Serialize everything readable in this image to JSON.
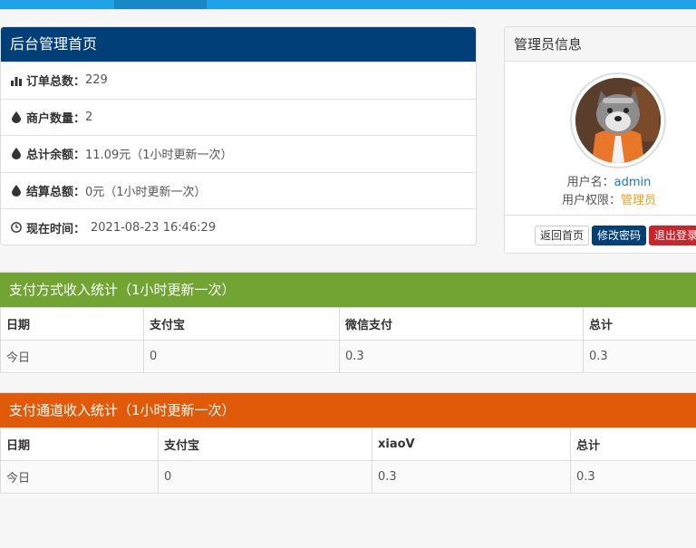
{
  "dashboard": {
    "title": "后台管理首页",
    "stats": [
      {
        "icon": "bar-chart-icon",
        "label": "订单总数：",
        "value": "229"
      },
      {
        "icon": "drop-icon",
        "label": "商户数量：",
        "value": "2"
      },
      {
        "icon": "drop-icon",
        "label": "总计余额：",
        "value": "11.09元（1小时更新一次）"
      },
      {
        "icon": "drop-icon",
        "label": "结算总额：",
        "value": "0元（1小时更新一次）"
      },
      {
        "icon": "clock-icon",
        "label": "现在时间：",
        "value": "2021-08-23 16:46:29"
      }
    ]
  },
  "admin": {
    "title": "管理员信息",
    "username_label": "用户名：",
    "username": "admin",
    "role_label": "用户权限：",
    "role": "管理员",
    "buttons": {
      "home": "返回首页",
      "change_password": "修改密码",
      "logout": "退出登录"
    }
  },
  "pay_stats": {
    "title": "支付方式收入统计（1小时更新一次）",
    "headers": [
      "日期",
      "支付宝",
      "微信支付",
      "总计"
    ],
    "row": [
      "今日",
      "0",
      "0.3",
      "0.3"
    ]
  },
  "channel_stats": {
    "title": "支付通道收入统计（1小时更新一次）",
    "headers": [
      "日期",
      "支付宝",
      "xiaoV",
      "总计"
    ],
    "row": [
      "今日",
      "0",
      "0.3",
      "0.3"
    ]
  },
  "colors": {
    "topbar": "#1fa3e8",
    "dashboard_header": "#003f78",
    "pay_header": "#72a434",
    "channel_header": "#e15a09",
    "username": "#1a6fd6",
    "role": "#f0a020",
    "logout": "#c9252b"
  }
}
